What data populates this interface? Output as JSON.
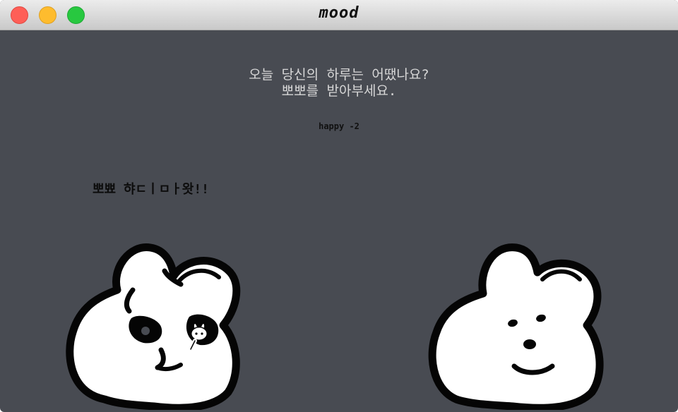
{
  "window": {
    "title": "mood"
  },
  "prompt": {
    "line1": "오늘 당신의 하루는 어땠나요?",
    "line2": "뽀뽀를 받아부세요."
  },
  "mood_status": "happy -2",
  "speech": "뽀뾰 햐ㄷㅣㅁㅏ왓!!",
  "bunnies": {
    "sad_icon": "sad-bunny-icon",
    "happy_icon": "happy-bunny-icon"
  },
  "colors": {
    "background": "#484b52",
    "titlebar": "#d6d6d6",
    "close": "#fe5f57",
    "minimize": "#febc2e",
    "maximize": "#28c840"
  }
}
